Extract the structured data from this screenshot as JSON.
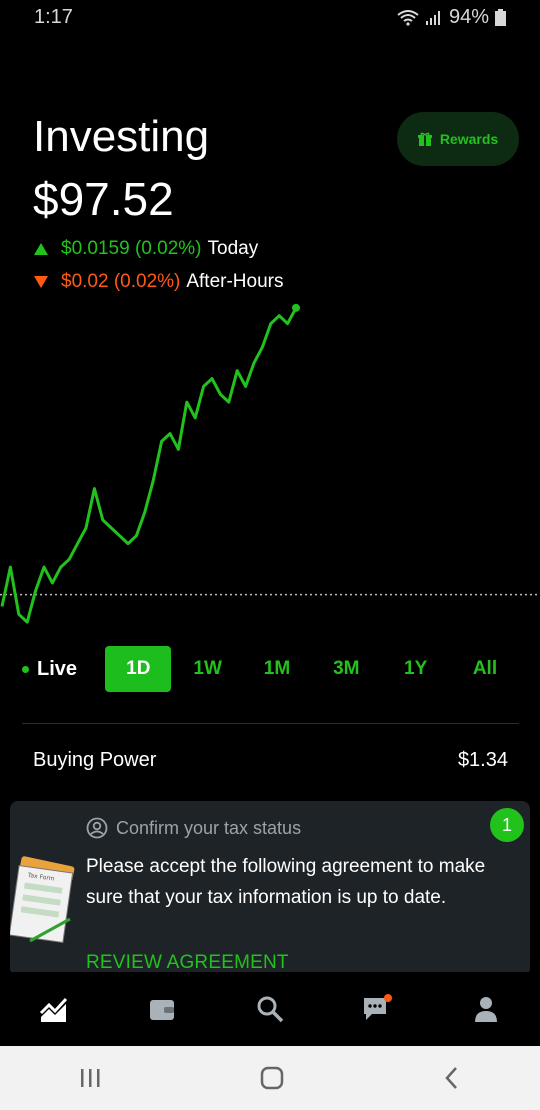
{
  "status_bar": {
    "time": "1:17",
    "battery": "94%"
  },
  "header": {
    "title": "Investing",
    "portfolio_value": "$97.52",
    "rewards_label": "Rewards"
  },
  "changes": {
    "today": {
      "amount": "$0.0159 (0.02%)",
      "label": "Today",
      "direction": "up",
      "color": "#22c21d"
    },
    "after_hours": {
      "amount": "$0.02 (0.02%)",
      "label": "After-Hours",
      "direction": "down",
      "color": "#ff5a12"
    }
  },
  "chart_data": {
    "type": "line",
    "series": [
      {
        "values": [
          96.8,
          97.3,
          96.7,
          96.6,
          97.0,
          97.3,
          97.1,
          97.3,
          97.4,
          97.6,
          97.8,
          98.3,
          97.9,
          97.8,
          97.7,
          97.6,
          97.7,
          98.0,
          98.4,
          98.9,
          99.0,
          98.8,
          99.4,
          99.2,
          99.6,
          99.7,
          99.5,
          99.4,
          99.8,
          99.6,
          99.9,
          100.1,
          100.4,
          100.5,
          100.4,
          100.6
        ]
      }
    ],
    "baseline": 96.95,
    "line_color": "#22c21d"
  },
  "timeframes": {
    "live_label": "Live",
    "items": [
      "1D",
      "1W",
      "1M",
      "3M",
      "1Y",
      "All"
    ],
    "selected": "1D"
  },
  "buying_power": {
    "label": "Buying Power",
    "value": "$1.34"
  },
  "tax_card": {
    "heading": "Confirm your tax status",
    "body": "Please accept the following agreement to make sure that your tax information is up to date.",
    "link": "REVIEW AGREEMENT",
    "badge": "1",
    "illustration_label": "Tax Form"
  },
  "bottom_nav": [
    "home-chart",
    "wallet",
    "search",
    "messages",
    "account"
  ]
}
